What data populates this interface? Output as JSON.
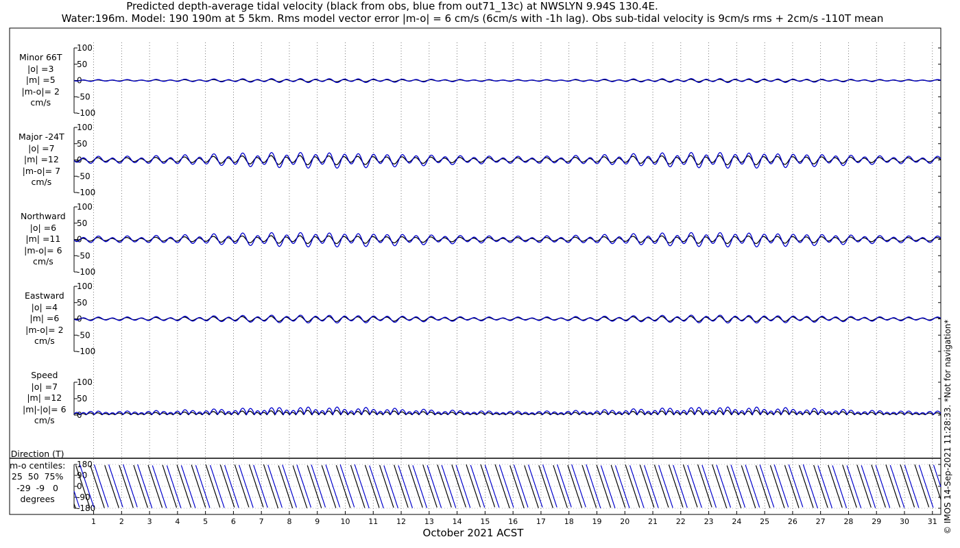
{
  "title_line1": "Predicted depth-average tidal velocity (black from obs, blue from out71_13c) at NWSLYN 9.94S 130.4E.",
  "title_line2": "Water:196m. Model: 190 190m at 5 5km. Rms model vector error |m-o| = 6 cm/s (6cm/s with -1h lag). Obs sub-tidal velocity is 9cm/s rms + 2cm/s -110T mean",
  "credit": "© IMOS 14-Sep-2021 11:28:33. *Not for navigation*",
  "panels": [
    {
      "label": "Minor 66T\n|o| =3\n|m| =5\n|m-o|= 2\ncm/s"
    },
    {
      "label": "Major -24T\n|o| =7\n|m| =12\n|m-o|= 7\ncm/s"
    },
    {
      "label": "Northward\n|o| =6\n|m| =11\n|m-o|= 6\ncm/s"
    },
    {
      "label": "Eastward\n|o| =4\n|m| =6\n|m-o|= 2\ncm/s"
    },
    {
      "label": "Speed\n|o| =7\n|m| =12\n|m|-|o|= 6\ncm/s"
    },
    {
      "label": "Direction (T)\nm-o centiles:\n25  50  75%\n-29  -9   0\ndegrees"
    }
  ],
  "chart_data": {
    "type": "line",
    "xlabel": "October 2021 ACST",
    "x_ticks": [
      "1",
      "2",
      "3",
      "4",
      "5",
      "6",
      "7",
      "8",
      "9",
      "10",
      "11",
      "12",
      "13",
      "14",
      "15",
      "16",
      "17",
      "18",
      "19",
      "20",
      "21",
      "22",
      "23",
      "24",
      "25",
      "26",
      "27",
      "28",
      "29",
      "30",
      "31"
    ],
    "xlim_days": [
      0.3,
      31.3
    ],
    "series_colors": {
      "obs": "#000000",
      "model": "#0000cc"
    },
    "panels": [
      {
        "name": "Minor 66T",
        "ylim": [
          -100,
          100
        ],
        "yticks": [
          "100",
          "50",
          "0",
          "-50",
          "-100"
        ],
        "amp_obs": 3,
        "amp_model": 5
      },
      {
        "name": "Major -24T",
        "ylim": [
          -100,
          100
        ],
        "yticks": [
          "100",
          "50",
          "0",
          "-50",
          "-100"
        ],
        "amp_obs": 7,
        "amp_model": 12
      },
      {
        "name": "Northward",
        "ylim": [
          -100,
          100
        ],
        "yticks": [
          "100",
          "50",
          "0",
          "-50",
          "-100"
        ],
        "amp_obs": 6,
        "amp_model": 11
      },
      {
        "name": "Eastward",
        "ylim": [
          -100,
          100
        ],
        "yticks": [
          "100",
          "50",
          "0",
          "-50",
          "-100"
        ],
        "amp_obs": 4,
        "amp_model": 6
      },
      {
        "name": "Speed",
        "ylim": [
          0,
          100
        ],
        "yticks": [
          "100",
          "50",
          "0"
        ],
        "amp_obs": 7,
        "amp_model": 12
      },
      {
        "name": "Direction (T)",
        "ylim": [
          -180,
          180
        ],
        "yticks": [
          "180",
          "90",
          "0",
          "-90",
          "-180"
        ]
      }
    ]
  }
}
